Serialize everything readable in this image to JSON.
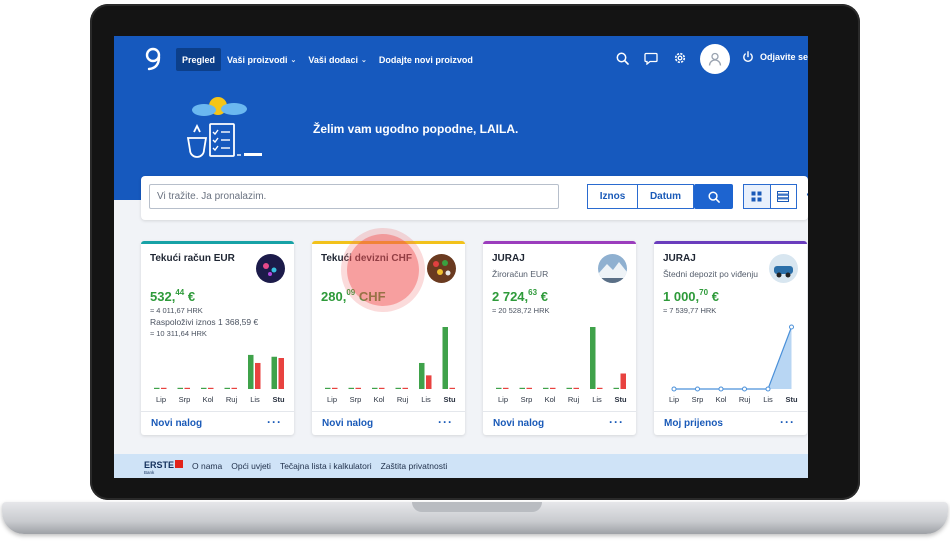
{
  "topbar": {
    "nav": [
      {
        "label": "Pregled",
        "dropdown": false,
        "active": true
      },
      {
        "label": "Vaši proizvodi",
        "dropdown": true,
        "active": false
      },
      {
        "label": "Vaši dodaci",
        "dropdown": true,
        "active": false
      },
      {
        "label": "Dodajte novi proizvod",
        "dropdown": false,
        "active": false
      }
    ],
    "icons": [
      "search-icon",
      "chat-icon",
      "gear-icon"
    ],
    "logout_label": "Odjavite se"
  },
  "hero": {
    "greeting": "Želim vam ugodno popodne,  LAILA."
  },
  "search": {
    "placeholder": "Vi tražite. Ja pronalazim.",
    "amount_label": "Iznos",
    "date_label": "Datum"
  },
  "cards": [
    {
      "title": "Tekući račun EUR",
      "subtitle": "",
      "amount_int": "532,",
      "amount_dec": "44",
      "amount_cur": "€",
      "lines": [
        "≈ 4 011,67 HRK",
        "Raspoloživi iznos 1 368,59 €",
        "≈ 10 311,64 HRK"
      ],
      "footer_link": "Novi nalog",
      "accent": "#17a2a6",
      "chart_data": {
        "type": "bar",
        "categories": [
          "Lip",
          "Srp",
          "Kol",
          "Ruj",
          "Lis",
          "Stu"
        ],
        "series": [
          {
            "values": [
              0,
              0,
              0,
              0,
              0.55,
              0.52
            ]
          },
          {
            "values": [
              0,
              0,
              0,
              0,
              0.42,
              0.5
            ]
          }
        ],
        "colors": [
          "#3fa24a",
          "#e8423f"
        ]
      }
    },
    {
      "title": "Tekući devizni CHF",
      "subtitle": "",
      "amount_int": "280,",
      "amount_dec": "09",
      "amount_cur": "CHF",
      "lines": [],
      "footer_link": "Novi nalog",
      "accent": "#f2c21b",
      "chart_data": {
        "type": "bar",
        "categories": [
          "Lip",
          "Srp",
          "Kol",
          "Ruj",
          "Lis",
          "Stu"
        ],
        "series": [
          {
            "values": [
              0,
              0,
              0,
              0,
              0.42,
              1.0
            ]
          },
          {
            "values": [
              0,
              0,
              0,
              0,
              0.22,
              0
            ]
          }
        ],
        "colors": [
          "#3fa24a",
          "#e8423f"
        ]
      }
    },
    {
      "title": "JURAJ",
      "subtitle": "Žiroračun EUR",
      "amount_int": "2 724,",
      "amount_dec": "63",
      "amount_cur": "€",
      "lines": [
        "≈ 20 528,72 HRK"
      ],
      "footer_link": "Novi nalog",
      "accent": "#9b3dbd",
      "chart_data": {
        "type": "bar",
        "categories": [
          "Lip",
          "Srp",
          "Kol",
          "Ruj",
          "Lis",
          "Stu"
        ],
        "series": [
          {
            "values": [
              0,
              0,
              0,
              0,
              1.0,
              0
            ]
          },
          {
            "values": [
              0,
              0,
              0,
              0,
              0,
              0.25
            ]
          }
        ],
        "colors": [
          "#3fa24a",
          "#e8423f"
        ]
      }
    },
    {
      "title": "JURAJ",
      "subtitle": "Štedni depozit po viđenju",
      "amount_int": "1 000,",
      "amount_dec": "70",
      "amount_cur": "€",
      "lines": [
        "≈ 7 539,77 HRK"
      ],
      "footer_link": "Moj prijenos",
      "accent": "#6a3dbd",
      "chart_data": {
        "type": "area",
        "categories": [
          "Lip",
          "Srp",
          "Kol",
          "Ruj",
          "Lis",
          "Stu"
        ],
        "values": [
          0,
          0,
          0,
          0,
          0,
          1.0
        ],
        "color": "#4a90d9"
      }
    }
  ],
  "footer": {
    "brand": "ERSTE",
    "brand_sub": "Bank",
    "links": [
      "O nama",
      "Opći uvjeti",
      "Tečajna lista i kalkulatori",
      "Zaštita privatnosti"
    ]
  }
}
